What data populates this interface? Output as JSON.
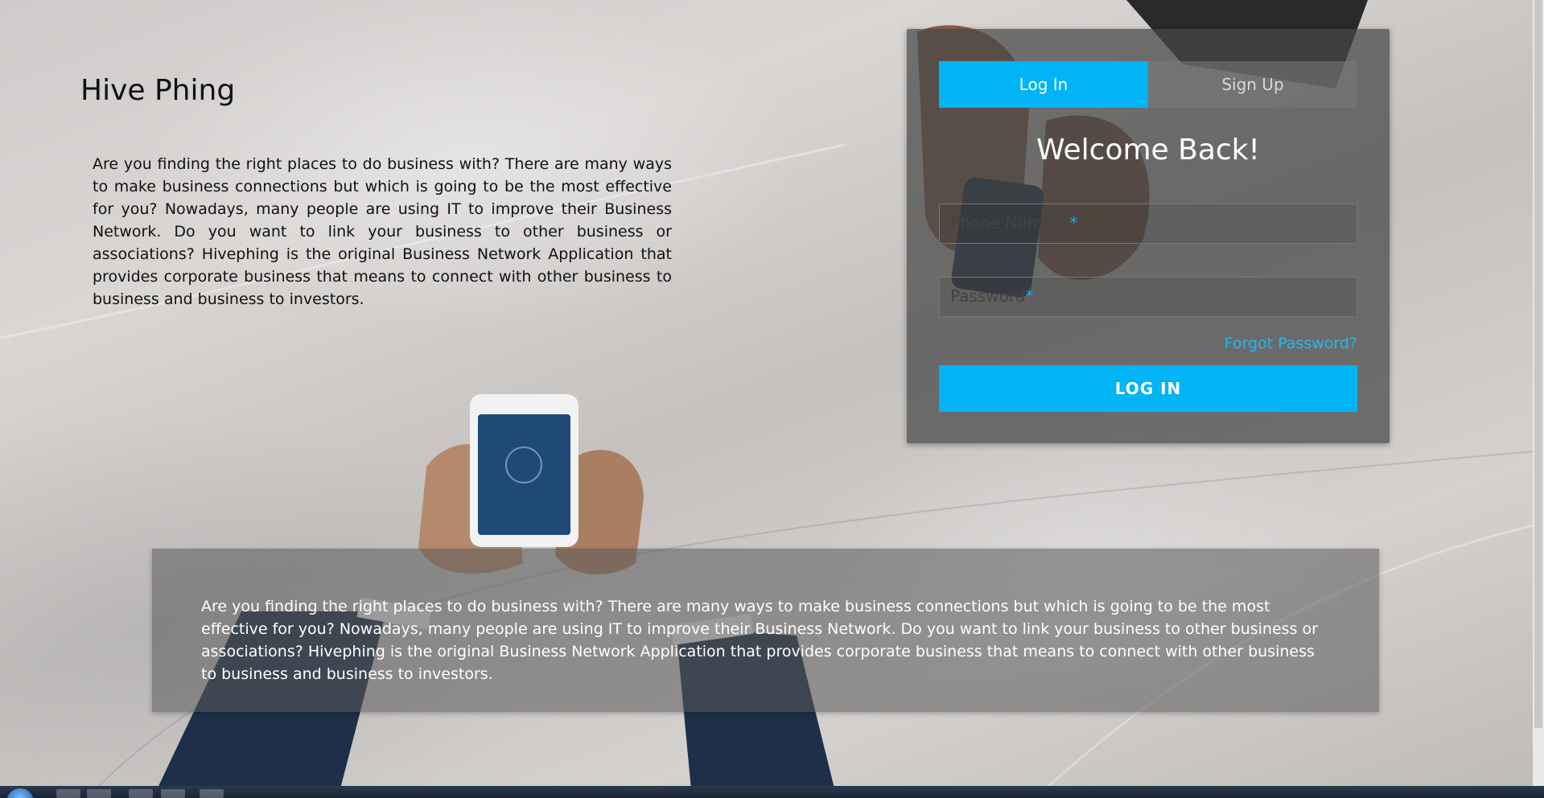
{
  "brand": {
    "title": "Hive Phing"
  },
  "intro": {
    "text": "Are you finding the right places to do business with? There are many ways to make business connections but which is going to be the most effective for you? Nowadays, many people are using IT to improve their Business Network. Do you want to link your business to other business or associations? Hivephing is the original Business Network Application that provides corporate business that means to connect with other business to business and business to investors."
  },
  "auth": {
    "tabs": {
      "login": "Log In",
      "signup": "Sign Up"
    },
    "welcome": "Welcome Back!",
    "phone": {
      "placeholder": "Phone Number",
      "required_mark": "*"
    },
    "password": {
      "placeholder": "Password",
      "required_mark": "*"
    },
    "forgot": "Forgot Password?",
    "submit": "LOG IN"
  },
  "banner": {
    "text": "Are you finding the right places to do business with? There are many ways to make business connections but which is going to be the most effective for you? Nowadays, many people are using IT to improve their Business Network. Do you want to link your business to other business or associations? Hivephing is the original Business Network Application that provides corporate business that means to connect with other business to business and business to investors."
  },
  "colors": {
    "accent": "#00b4f5",
    "card_bg": "#464646",
    "banner_bg": "#5a5a5a"
  }
}
